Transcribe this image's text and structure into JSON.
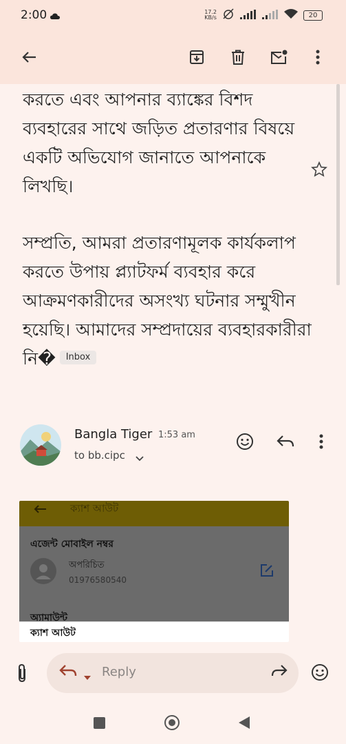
{
  "status_bar": {
    "time": "2:00",
    "net_speed_value": "17.2",
    "net_speed_unit": "KB/s",
    "battery": "20"
  },
  "app_bar": {
    "back_icon": "arrow-left-icon",
    "archive_icon": "archive-icon",
    "delete_icon": "trash-icon",
    "mark_unread_icon": "mail-unread-icon",
    "more_icon": "more-vertical-icon"
  },
  "message": {
    "paragraph1": "করতে এবং আপনার ব্যাঙ্কের বিশদ ব্যবহারের সাথে জড়িত প্রতারণার বিষয়ে একটি অভিযোগ জানাতে আপনাকে লিখছি।",
    "paragraph2": "সম্প্রতি, আমরা প্রতারণামূলক কার্যকলাপ করতে উপায় প্ল্যাটফর্ম ব্যবহার করে আক্রমণকারীদের অসংখ্য ঘটনার সম্মুখীন হয়েছি। আমাদের সম্প্রদায়ের ব্যবহারকারীরা নি�",
    "label_chip": "Inbox"
  },
  "sender": {
    "name": "Bangla Tiger",
    "time": "1:53 am",
    "to": "to bb.cipc"
  },
  "attachment_preview": {
    "title": "ক্যাশ আউট",
    "agent_label": "এজেন্ট মোবাইল নম্বর",
    "contact_name": "অপরিচিত",
    "contact_number": "01976580540",
    "amount_label": "অ্যামাউন্ট",
    "footer_label": "ক্যাশ আউট"
  },
  "reply_bar": {
    "placeholder": "Reply"
  },
  "colors": {
    "background": "#fdf2ee",
    "app_bar": "#fbe5dc",
    "preview_header": "#6e5d05"
  }
}
